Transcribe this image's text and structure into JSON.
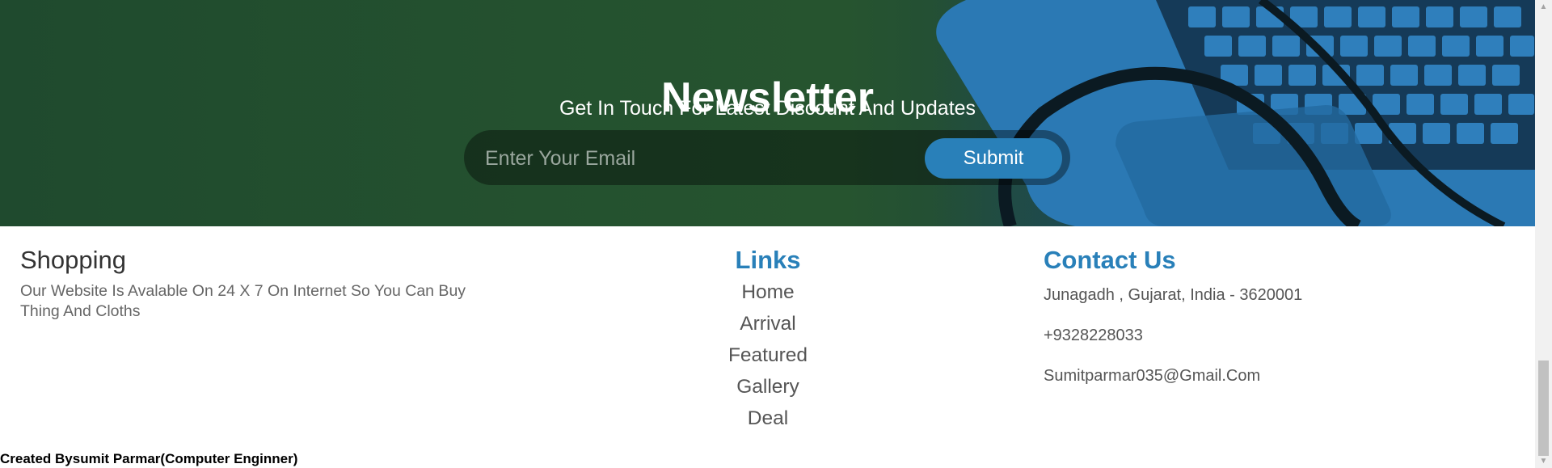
{
  "newsletter": {
    "title": "Newsletter",
    "subtitle": "Get In Touch For Latest Discount And Updates",
    "email_placeholder": "Enter Your Email",
    "submit_label": "Submit",
    "background_image": "laptop-keyboard-with-stethoscope"
  },
  "footer": {
    "shopping": {
      "title": "Shopping",
      "text": "Our Website Is Avalable On 24 X 7 On Internet So You Can Buy Thing And Cloths"
    },
    "links": {
      "title": "Links",
      "items": [
        "Home",
        "Arrival",
        "Featured",
        "Gallery",
        "Deal"
      ]
    },
    "contact": {
      "title": "Contact Us",
      "address": "Junagadh , Gujarat, India - 3620001",
      "phone": "+9328228033",
      "email": "Sumitparmar035@Gmail.Com"
    },
    "credit": "Created Bysumit Parmar(Computer Enginner)"
  },
  "scrollbar": {
    "up_icon": "triangle-up",
    "down_icon": "triangle-down"
  },
  "colors": {
    "accent": "#2980b9",
    "banner_green": "#24512f",
    "banner_blue": "#1a3c58",
    "heading_dark": "#333333",
    "text_grey": "#555555"
  }
}
